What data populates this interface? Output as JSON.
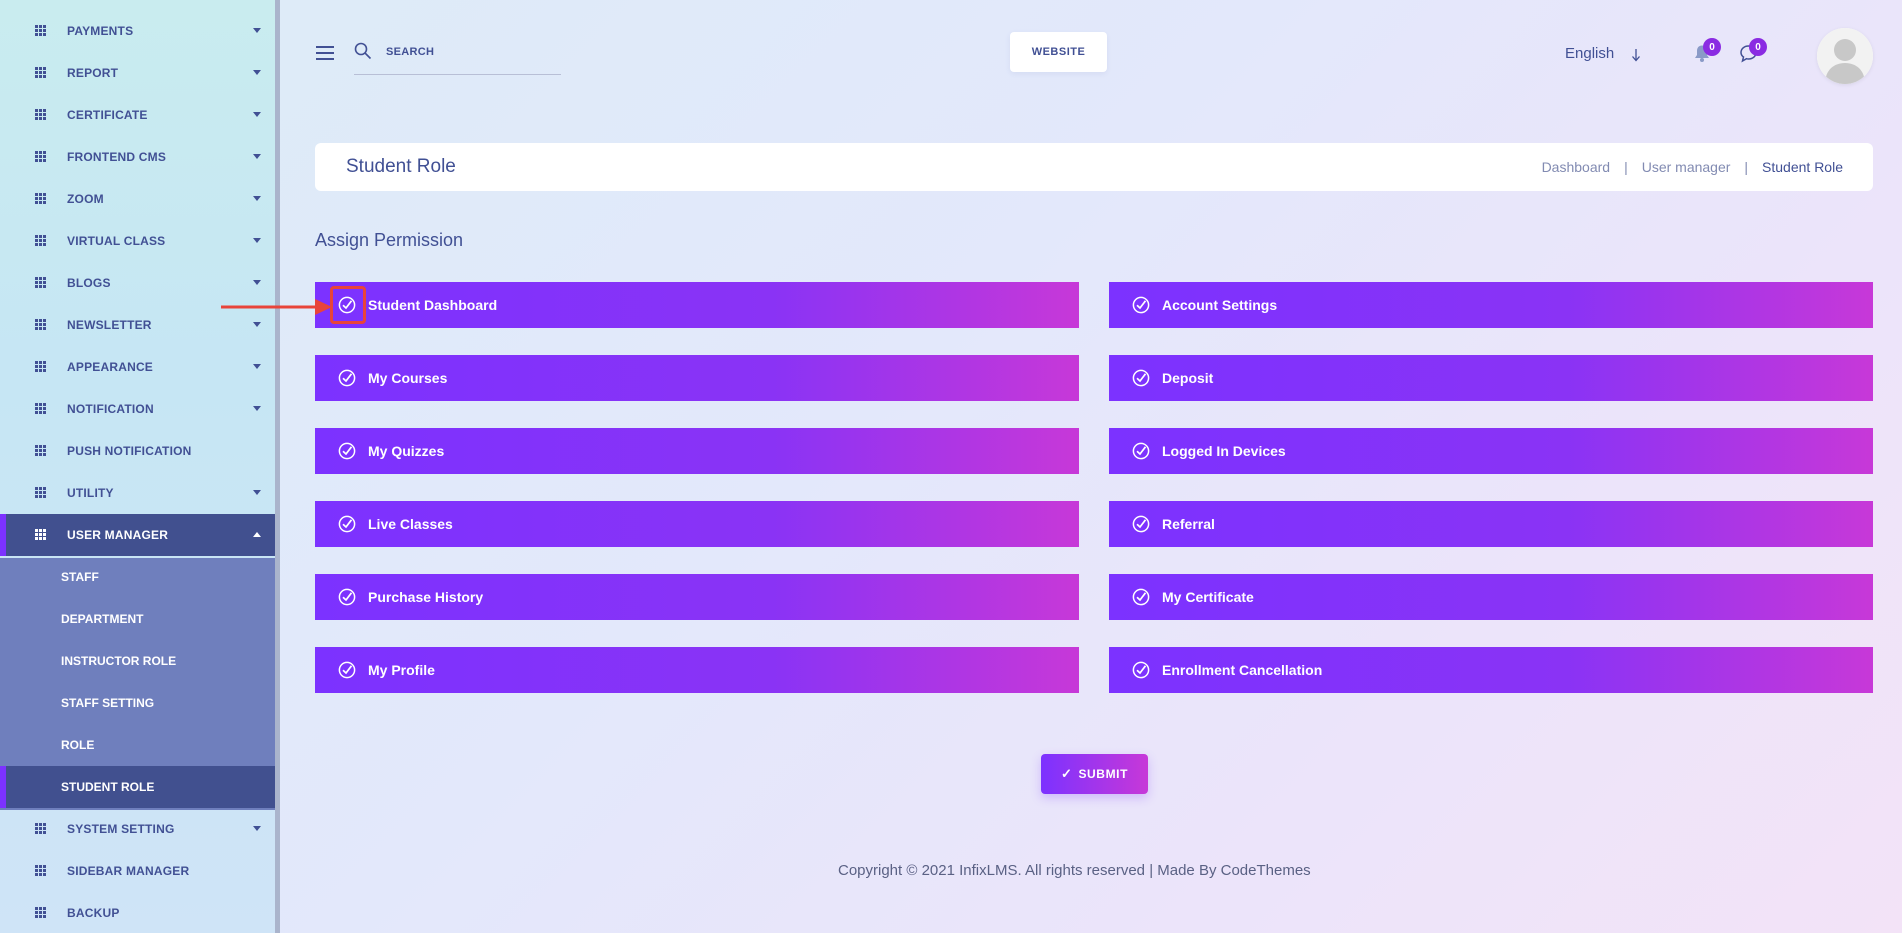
{
  "sidebar": {
    "items": [
      {
        "label": "PAYMENTS",
        "caret": "down"
      },
      {
        "label": "REPORT",
        "caret": "down"
      },
      {
        "label": "CERTIFICATE",
        "caret": "down"
      },
      {
        "label": "FRONTEND CMS",
        "caret": "down"
      },
      {
        "label": "ZOOM",
        "caret": "down"
      },
      {
        "label": "VIRTUAL CLASS",
        "caret": "down"
      },
      {
        "label": "BLOGS",
        "caret": "down"
      },
      {
        "label": "NEWSLETTER",
        "caret": "down"
      },
      {
        "label": "APPEARANCE",
        "caret": "down"
      },
      {
        "label": "NOTIFICATION",
        "caret": "down"
      },
      {
        "label": "PUSH NOTIFICATION",
        "caret": "none"
      },
      {
        "label": "UTILITY",
        "caret": "down"
      },
      {
        "label": "USER MANAGER",
        "caret": "up",
        "active": true
      },
      {
        "label": "SYSTEM SETTING",
        "caret": "down"
      },
      {
        "label": "SIDEBAR MANAGER",
        "caret": "none"
      },
      {
        "label": "BACKUP",
        "caret": "none"
      }
    ],
    "submenu": [
      {
        "label": "STAFF"
      },
      {
        "label": "DEPARTMENT"
      },
      {
        "label": "INSTRUCTOR ROLE"
      },
      {
        "label": "STAFF SETTING"
      },
      {
        "label": "ROLE"
      },
      {
        "label": "STUDENT ROLE",
        "active": true
      }
    ]
  },
  "header": {
    "search_placeholder": "SEARCH",
    "website_label": "WEBSITE",
    "language": "English",
    "notification_count": "0",
    "message_count": "0"
  },
  "page": {
    "title": "Student Role",
    "breadcrumb": [
      "Dashboard",
      "User manager",
      "Student Role"
    ],
    "section_title": "Assign Permission"
  },
  "permissions": {
    "left": [
      "Student Dashboard",
      "My Courses",
      "My Quizzes",
      "Live Classes",
      "Purchase History",
      "My Profile"
    ],
    "right": [
      "Account Settings",
      "Deposit",
      "Logged In Devices",
      "Referral",
      "My Certificate",
      "Enrollment Cancellation"
    ]
  },
  "submit_label": "SUBMIT",
  "footer_text": "Copyright © 2021 InfixLMS. All rights reserved | Made By CodeThemes",
  "colors": {
    "primary": "#7c32ff",
    "gradient_end": "#c738d8",
    "text": "#415094",
    "highlight": "#e8443a"
  }
}
